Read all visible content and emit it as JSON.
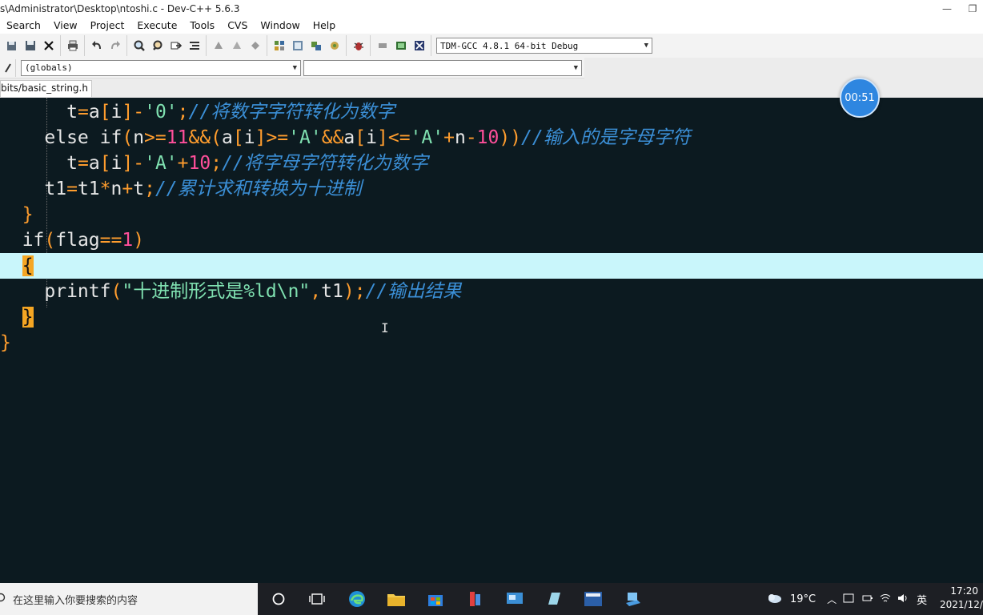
{
  "window": {
    "title": "s\\Administrator\\Desktop\\ntoshi.c - Dev-C++ 5.6.3",
    "minimize_glyph": "—",
    "restore_glyph": "❐"
  },
  "menu": [
    "Search",
    "View",
    "Project",
    "Execute",
    "Tools",
    "CVS",
    "Window",
    "Help"
  ],
  "toolbar": {
    "compiler": "TDM-GCC 4.8.1 64-bit Debug",
    "icons": [
      "open-icon",
      "save-all-icon",
      "close-icon",
      "print-icon",
      "undo-icon",
      "redo-icon",
      "find-icon",
      "replace-icon",
      "goto-icon",
      "indent-icon",
      "compile-icon",
      "run-icon",
      "compile-run-icon",
      "rebuild-icon",
      "debug-icon",
      "stop-icon",
      "profile-icon",
      "check-icon",
      "chart-icon"
    ]
  },
  "scope": {
    "class_value": "(globals)",
    "member_value": ""
  },
  "tab": {
    "label": "bits/basic_string.h"
  },
  "timer": {
    "value": "00:51"
  },
  "code": {
    "line1": {
      "indent": "      ",
      "a": "t",
      "b": "=",
      "c": "a",
      "d": "[",
      "e": "i",
      "f": "]",
      "g": "-",
      "h": "'0'",
      "i": ";",
      "comment": "//将数字字符转化为数字"
    },
    "line2": {
      "indent": "    ",
      "kw1": "else if",
      "p1": "(",
      "n1": "n",
      "op1": ">=",
      "num1": "11",
      "op2": "&&",
      "p2": "(",
      "a1": "a",
      "b1": "[",
      "i1": "i",
      "b2": "]",
      "op3": ">=",
      "chr1": "'A'",
      "op4": "&&",
      "a2": "a",
      "b3": "[",
      "i2": "i",
      "b4": "]",
      "op5": "<=",
      "chr2": "'A'",
      "op6": "+",
      "n2": "n",
      "op7": "-",
      "num2": "10",
      "p3": "))",
      "comment": "//输入的是字母字符"
    },
    "line3": {
      "indent": "      ",
      "a": "t",
      "b": "=",
      "c": "a",
      "d": "[",
      "e": "i",
      "f": "]",
      "g": "-",
      "h": "'A'",
      "j": "+",
      "k": "10",
      "i": ";",
      "comment": "//将字母字符转化为数字"
    },
    "line4": {
      "indent": "    ",
      "a": "t1",
      "b": "=",
      "c": "t1",
      "d": "*",
      "e": "n",
      "f": "+",
      "g": "t",
      "i": ";",
      "comment": "//累计求和转换为十进制"
    },
    "line5": {
      "indent": "  ",
      "brace": "}"
    },
    "line6": {
      "indent": "  ",
      "kw": "if",
      "p1": "(",
      "v": "flag",
      "op": "==",
      "num": "1",
      "p2": ")"
    },
    "line7": {
      "indent": "  ",
      "brace": "{"
    },
    "line8": {
      "indent": "    ",
      "fn": "printf",
      "p1": "(",
      "str": "\"十进制形式是%ld\\n\"",
      "comma": ",",
      "arg": "t1",
      "p2": ")",
      "semi": ";",
      "comment": "//输出结果"
    },
    "line9": {
      "indent": "  ",
      "brace": "}"
    },
    "line10": {
      "brace": "}"
    }
  },
  "taskbar": {
    "search_placeholder": "在这里输入你要搜索的内容",
    "weather": "19°C",
    "ime": "英",
    "time": "17:20",
    "date": "2021/12/"
  }
}
